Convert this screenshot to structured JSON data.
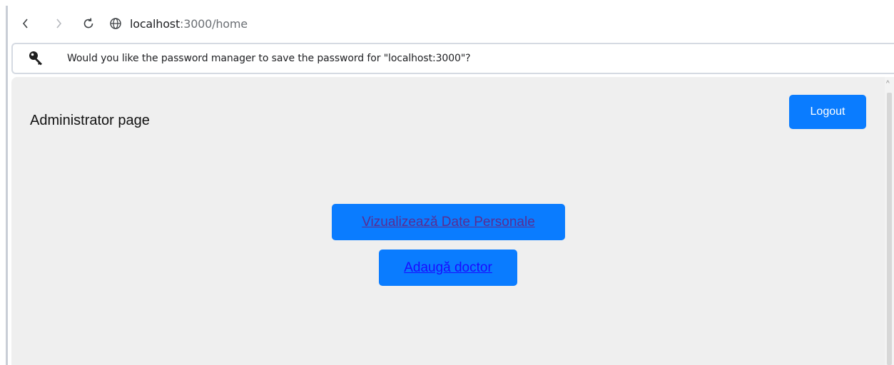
{
  "browser": {
    "url_host": "localhost",
    "url_path": ":3000/home"
  },
  "password_prompt": {
    "message": "Would you like the password manager to save the password for \"localhost:3000\"?"
  },
  "page": {
    "title": "Administrator page",
    "logout_label": "Logout",
    "view_personal_data_label": "Vizualizează Date Personale",
    "add_doctor_label": "Adaugă doctor"
  },
  "colors": {
    "button_blue": "#0a7cff",
    "page_background": "#efefef",
    "visited_link": "#5a2d91",
    "link": "#1a0dff"
  },
  "icons": {
    "back": "back-arrow-icon",
    "forward": "forward-arrow-icon",
    "reload": "reload-icon",
    "site_info": "globe-icon",
    "key": "key-icon"
  }
}
